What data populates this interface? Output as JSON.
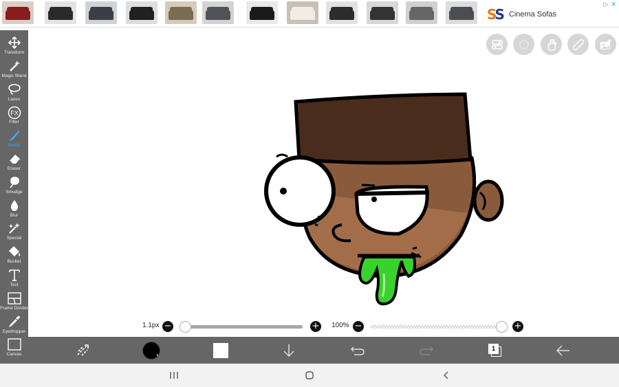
{
  "ad": {
    "thumbnails": [
      {
        "name": "red-recliner",
        "wall": "#d9cfc8",
        "sofa": "#8a1c1c"
      },
      {
        "name": "black-sectional",
        "wall": "#e4e4e4",
        "sofa": "#2a2a2a"
      },
      {
        "name": "grey-sofa",
        "wall": "#cfd2d6",
        "sofa": "#3b3f45"
      },
      {
        "name": "black-recliner",
        "wall": "#dedede",
        "sofa": "#202020"
      },
      {
        "name": "bed-frame",
        "wall": "#d6cbb8",
        "sofa": "#7a6b55"
      },
      {
        "name": "grey-loveseat",
        "wall": "#d3d3d3",
        "sofa": "#505458"
      },
      {
        "name": "black-leather",
        "wall": "#e9e9e9",
        "sofa": "#1a1a1a"
      },
      {
        "name": "white-sofa",
        "wall": "#c9c0b5",
        "sofa": "#f0ede6"
      },
      {
        "name": "dark-sectional",
        "wall": "#e2e2e2",
        "sofa": "#2c2c2c"
      },
      {
        "name": "charcoal-recliner",
        "wall": "#d8d8d8",
        "sofa": "#333"
      },
      {
        "name": "grey-set",
        "wall": "#d0d0d0",
        "sofa": "#666"
      },
      {
        "name": "slate-sofa",
        "wall": "#dcdcdc",
        "sofa": "#4a4d52"
      }
    ],
    "brand_logo": "SS",
    "brand_name": "Cinema Sofas"
  },
  "tools": [
    {
      "id": "transform",
      "label": "Transform",
      "icon": "move-arrows-icon"
    },
    {
      "id": "magic-wand",
      "label": "Magic Wand",
      "icon": "magic-wand-icon"
    },
    {
      "id": "lasso",
      "label": "Lasso",
      "icon": "lasso-icon"
    },
    {
      "id": "filter",
      "label": "Filter",
      "icon": "fx-icon"
    },
    {
      "id": "brush",
      "label": "Brush",
      "icon": "brush-icon",
      "active": true
    },
    {
      "id": "eraser",
      "label": "Eraser",
      "icon": "eraser-icon"
    },
    {
      "id": "smudge",
      "label": "Smudge",
      "icon": "smudge-icon"
    },
    {
      "id": "blur",
      "label": "Blur",
      "icon": "droplet-icon"
    },
    {
      "id": "special",
      "label": "Special",
      "icon": "sparkle-icon"
    },
    {
      "id": "bucket",
      "label": "Bucket",
      "icon": "bucket-icon"
    },
    {
      "id": "text",
      "label": "Text",
      "icon": "text-icon"
    },
    {
      "id": "frame-divider",
      "label": "Frame Divider",
      "icon": "frame-divider-icon"
    },
    {
      "id": "eyedropper",
      "label": "Eyedropper",
      "icon": "eyedropper-icon"
    },
    {
      "id": "canvas",
      "label": "Canvas",
      "icon": "canvas-icon"
    }
  ],
  "top_right_buttons": [
    "settings-toggle-icon",
    "circle-icon",
    "hand-icon",
    "ruler-icon",
    "image-icon"
  ],
  "brush": {
    "size_label": "1.1px",
    "opacity_label": "100%",
    "size_value": 0.0,
    "opacity_value": 1.0,
    "minus": "−",
    "plus": "+"
  },
  "colors": {
    "primary": "#000000",
    "secondary": "#ffffff",
    "active_tool": "#3fa9f5",
    "hat": "#4a2c1c",
    "skin": "#8a5a3c",
    "skin_light": "#a46d4a",
    "slime": "#39d12c"
  },
  "layers": {
    "count": "1"
  }
}
